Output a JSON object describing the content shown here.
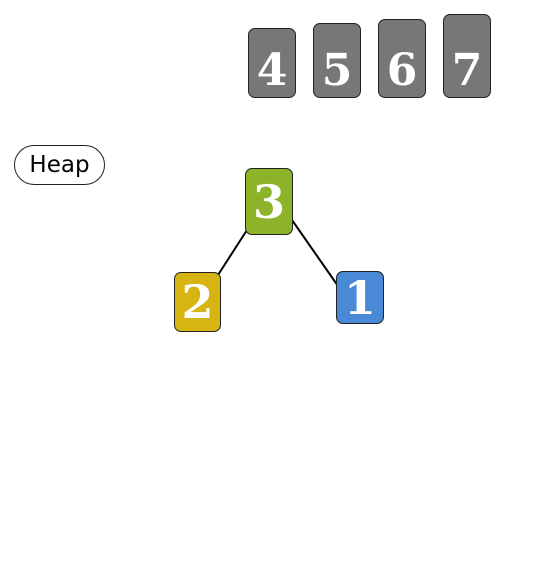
{
  "heap_label": "Heap",
  "sorted_values": [
    "4",
    "5",
    "6",
    "7"
  ],
  "heap": {
    "root": {
      "value": "3",
      "color": "#8db32a"
    },
    "left": {
      "value": "2",
      "color": "#d6b411"
    },
    "right": {
      "value": "1",
      "color": "#4a89d6"
    }
  },
  "colors": {
    "sorted_tile": "#777777",
    "edge": "#000000"
  }
}
